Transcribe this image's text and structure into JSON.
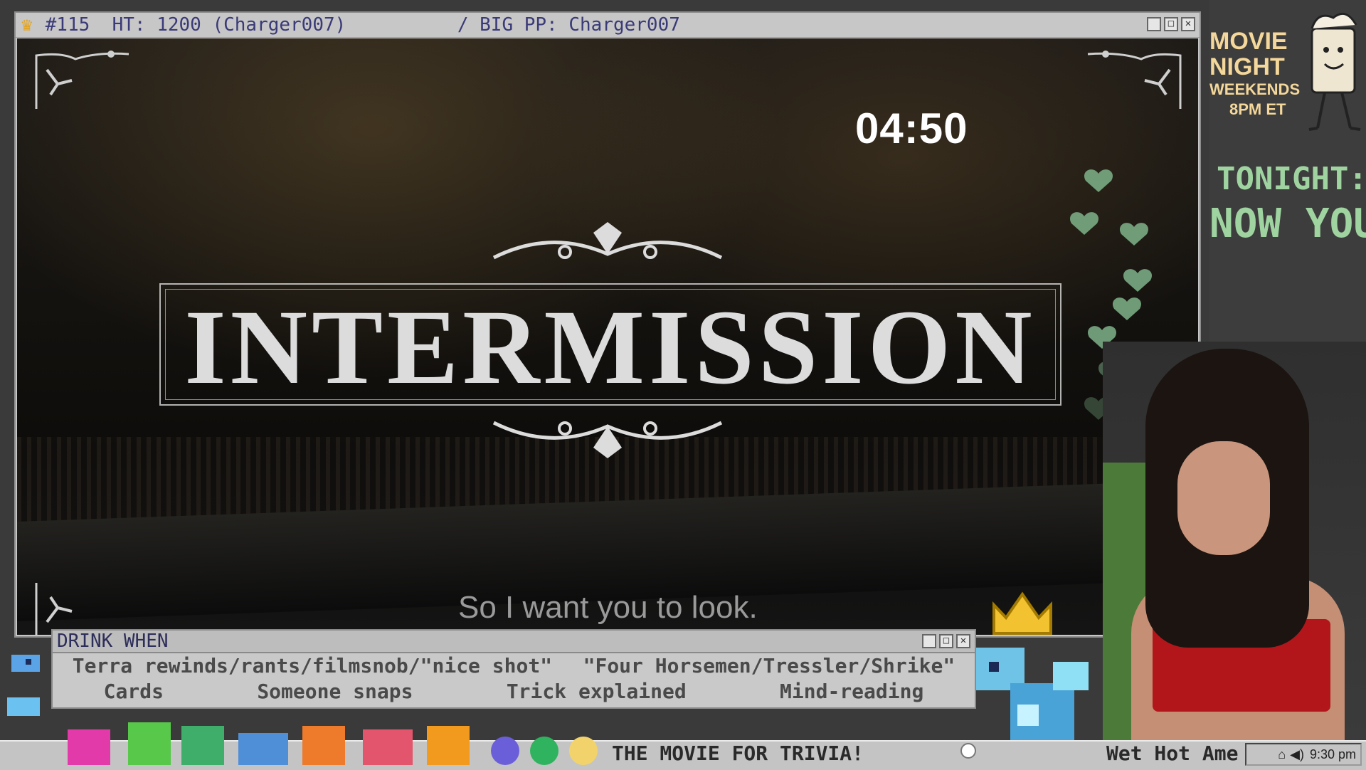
{
  "title_bar": {
    "text": "#115  HT: 1200 (Charger007)          / BIG PP: Charger007"
  },
  "video": {
    "timer": "04:50",
    "title": "INTERMISSION",
    "subtitle": "So I want you to look."
  },
  "sidebar": {
    "promo_line1": "MOVIE",
    "promo_line2": "NIGHT",
    "promo_line3": "WEEKENDS",
    "promo_line4": "8PM ET",
    "tonight_label": "TONIGHT:",
    "tonight_value": "NOW YOU"
  },
  "drink_panel": {
    "title": "DRINK WHEN",
    "row1": [
      "Terra rewinds/rants/filmsnob/\"nice shot\"",
      "\"Four Horsemen/Tressler/Shrike\""
    ],
    "row2": [
      "Cards",
      "Someone snaps",
      "Trick explained",
      "Mind-reading"
    ]
  },
  "taskbar": {
    "ticker_left": "THE MOVIE FOR TRIVIA!",
    "ticker_right": "Wet Hot Ame",
    "clock": "9:30 pm"
  },
  "colors": {
    "accent_green": "#9fd4a1",
    "promo_gold": "#f4d79a",
    "title_text": "#3a3a78"
  }
}
